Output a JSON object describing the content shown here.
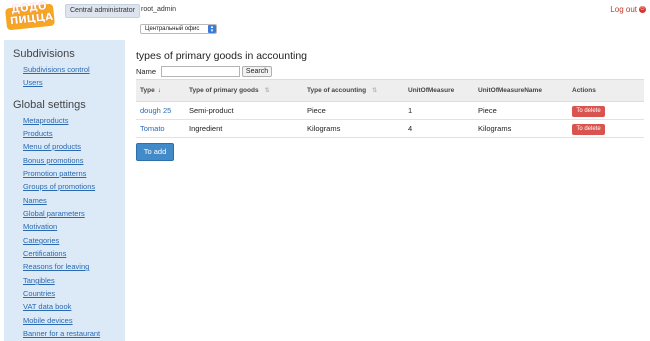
{
  "header": {
    "logo_line1": "ДОДО",
    "logo_line2": "ПИЦЦА",
    "role_tab": "Central administrator",
    "user": "root_admin",
    "logout": "Log out"
  },
  "office_select": {
    "value": "Центральный офис"
  },
  "sidebar": {
    "sections": [
      {
        "title": "Subdivisions",
        "items": [
          "Subdivisions control",
          "Users"
        ]
      },
      {
        "title": "Global settings",
        "items": [
          "Metaproducts",
          "Products",
          "Menu of products",
          "Bonus promotions",
          "Promotion patterns",
          "Groups of promotions",
          "Names",
          "Global parameters",
          "Motivation",
          "Categories",
          "Certifications",
          "Reasons for leaving",
          "Tangibles",
          "Countries",
          "VAT data book",
          "Mobile devices",
          "Banner for a restaurant"
        ]
      }
    ]
  },
  "main": {
    "title": "types of primary goods in accounting",
    "filter": {
      "label": "Name",
      "value": "",
      "placeholder": "",
      "search_label": "Search"
    },
    "table": {
      "columns": [
        "Type",
        "Type of primary goods",
        "Type of accounting",
        "UnitOfMeasure",
        "UnitOfMeasureName",
        "Actions"
      ],
      "rows": [
        {
          "type": "dough 25",
          "primary": "Semi-product",
          "accounting": "Piece",
          "uom": "1",
          "uom_name": "Piece",
          "action": "To delete"
        },
        {
          "type": "Tomato",
          "primary": "Ingredient",
          "accounting": "Kilograms",
          "uom": "4",
          "uom_name": "Kilograms",
          "action": "To delete"
        }
      ]
    },
    "add_label": "To add"
  },
  "colors": {
    "accent": "#428bca",
    "danger": "#d9534f",
    "sidebar_bg": "#dce9f7",
    "logo": "#f6a623",
    "logout": "#c0392b"
  }
}
